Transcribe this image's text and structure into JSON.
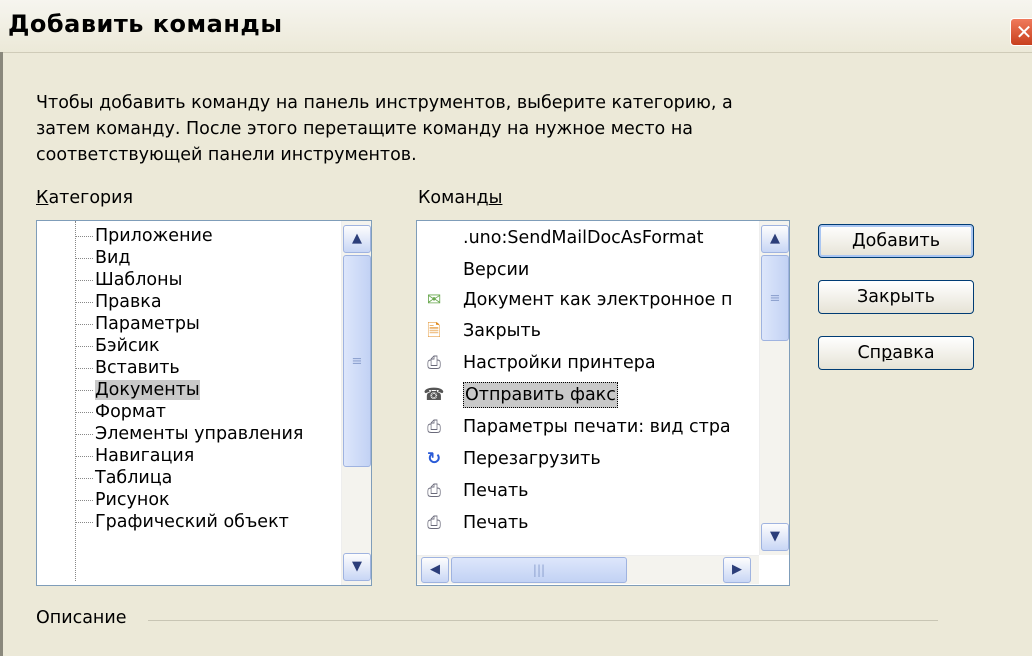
{
  "window": {
    "title": "Добавить команды",
    "close_label": "✕"
  },
  "description": "Чтобы добавить команду на панель инструментов, выберите категорию, а затем команду. После этого перетащите команду на нужное место на соответствующей панели инструментов.",
  "category": {
    "label_access": "К",
    "label_rest": "атегория",
    "items": [
      "Приложение",
      "Вид",
      "Шаблоны",
      "Правка",
      "Параметры",
      "Бэйсик",
      "Вставить",
      "Документы",
      "Формат",
      "Элементы управления",
      "Навигация",
      "Таблица",
      "Рисунок",
      "Графический объект"
    ],
    "selected": "Документы"
  },
  "commands": {
    "label_main": "Команд",
    "label_access": "ы",
    "items": [
      {
        "label": ".uno:SendMailDocAsFormat",
        "icon": "none"
      },
      {
        "label": "Версии",
        "icon": "none"
      },
      {
        "label": "Документ как электронное п",
        "icon": "envelope-icon"
      },
      {
        "label": "Закрыть",
        "icon": "close-doc-icon"
      },
      {
        "label": "Настройки принтера",
        "icon": "printer-settings-icon"
      },
      {
        "label": "Отправить факс",
        "icon": "fax-icon"
      },
      {
        "label": "Параметры печати: вид стра",
        "icon": "print-options-icon"
      },
      {
        "label": "Перезагрузить",
        "icon": "reload-icon"
      },
      {
        "label": "Печать",
        "icon": "printer-icon"
      },
      {
        "label": "Печать",
        "icon": "printer-icon"
      }
    ],
    "selected": "Отправить факс"
  },
  "buttons": {
    "add": "Добавить",
    "close": "Закрыть",
    "help_pre": "Сп",
    "help_access": "р",
    "help_post": "авка"
  },
  "description_group": "Описание"
}
